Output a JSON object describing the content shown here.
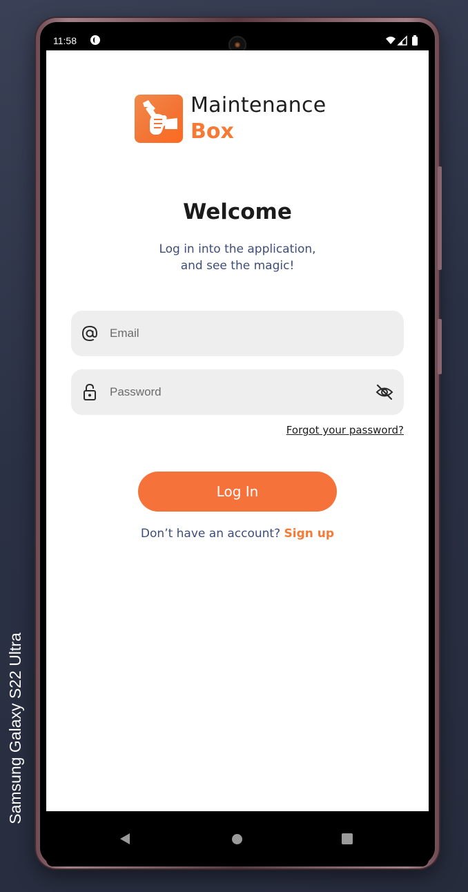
{
  "device": {
    "label": "Samsung Galaxy  S22 Ultra"
  },
  "status_bar": {
    "time": "11:58",
    "icons": [
      "wifi-icon",
      "signal-icon",
      "battery-icon"
    ]
  },
  "app": {
    "logo": {
      "line1": "Maintenance",
      "line2": "Box",
      "icon": "wrench-hand-logo"
    },
    "welcome": "Welcome",
    "subtitle_line1": "Log in into the application,",
    "subtitle_line2": "and see the magic!",
    "email": {
      "placeholder": "Email",
      "value": "",
      "icon": "at-icon"
    },
    "password": {
      "placeholder": "Password",
      "value": "",
      "icon": "lock-icon",
      "toggle_icon": "eye-off-icon"
    },
    "forgot_label": "Forgot your password?",
    "login_label": "Log In",
    "signup_prompt": "Don’t have an account?",
    "signup_label": "Sign up"
  },
  "nav_bar": {
    "buttons": [
      "back-icon",
      "home-icon",
      "recent-apps-icon"
    ]
  },
  "colors": {
    "accent": "#f5723a",
    "text_secondary": "#3f4d7a",
    "field_bg": "#eeeeee"
  }
}
